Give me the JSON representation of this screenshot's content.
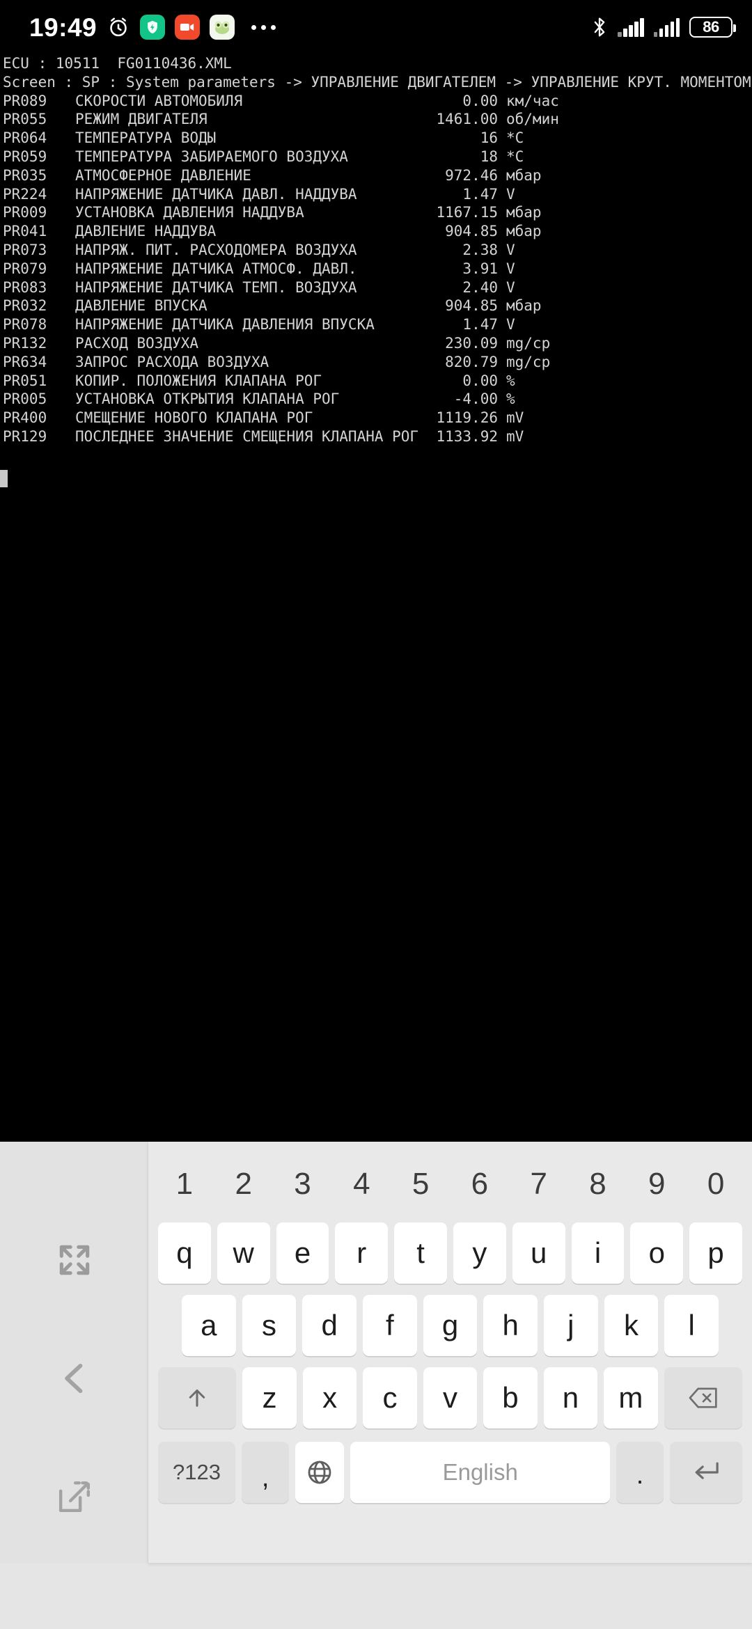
{
  "statusbar": {
    "clock": "19:49",
    "alarm_icon": "alarm-clock-icon",
    "app_icons": [
      {
        "name": "security-shield-app-icon",
        "bg": "#12c487",
        "glyph": "⚡"
      },
      {
        "name": "video-camera-app-icon",
        "bg": "#f0492b",
        "glyph": "■"
      },
      {
        "name": "frog-face-app-icon",
        "bg": "#f3f7ee",
        "glyph": "●"
      }
    ],
    "overflow_label": "•••",
    "bluetooth_icon": "bluetooth-icon",
    "signal_icon": "cellular-signal-icon",
    "battery_level": "86"
  },
  "console": {
    "header_ecu": "ECU : 10511  FG0110436.XML",
    "header_screen": "Screen : SP : System parameters -> УПРАВЛЕНИЕ ДВИГАТЕЛЕМ -> УПРАВЛЕНИЕ КРУТ. МОМЕНТОМ",
    "rows": [
      {
        "id": "PR089",
        "name": "СКОРОСТИ АВТОМОБИЛЯ",
        "value": "0.00",
        "unit": "км/час"
      },
      {
        "id": "PR055",
        "name": "РЕЖИМ ДВИГАТЕЛЯ",
        "value": "1461.00",
        "unit": "об/мин"
      },
      {
        "id": "PR064",
        "name": "ТЕМПЕРАТУРА ВОДЫ",
        "value": "16",
        "unit": "*C"
      },
      {
        "id": "PR059",
        "name": "ТЕМПЕРАТУРА ЗАБИРАЕМОГО ВОЗДУХА",
        "value": "18",
        "unit": "*C"
      },
      {
        "id": "PR035",
        "name": "АТМОСФЕРНОЕ ДАВЛЕНИЕ",
        "value": "972.46",
        "unit": "мбар"
      },
      {
        "id": "PR224",
        "name": "НАПРЯЖЕНИЕ ДАТЧИКА ДАВЛ. НАДДУВА",
        "value": "1.47",
        "unit": "V"
      },
      {
        "id": "PR009",
        "name": "УСТАНОВКА ДАВЛЕНИЯ НАДДУВА",
        "value": "1167.15",
        "unit": "мбар"
      },
      {
        "id": "PR041",
        "name": "ДАВЛЕНИЕ НАДДУВА",
        "value": "904.85",
        "unit": "мбар"
      },
      {
        "id": "PR073",
        "name": "НАПРЯЖ. ПИТ. РАСХОДОМЕРА ВОЗДУХА",
        "value": "2.38",
        "unit": "V"
      },
      {
        "id": "PR079",
        "name": "НАПРЯЖЕНИЕ ДАТЧИКА АТМОСФ. ДАВЛ.",
        "value": "3.91",
        "unit": "V"
      },
      {
        "id": "PR083",
        "name": "НАПРЯЖЕНИЕ ДАТЧИКА ТЕМП. ВОЗДУХА",
        "value": "2.40",
        "unit": "V"
      },
      {
        "id": "PR032",
        "name": "ДАВЛЕНИЕ ВПУСКА",
        "value": "904.85",
        "unit": "мбар"
      },
      {
        "id": "PR078",
        "name": "НАПРЯЖЕНИЕ ДАТЧИКА ДАВЛЕНИЯ ВПУСКА",
        "value": "1.47",
        "unit": "V"
      },
      {
        "id": "PR132",
        "name": "РАСХОД ВОЗДУХА",
        "value": "230.09",
        "unit": "mg/cp"
      },
      {
        "id": "PR634",
        "name": "ЗАПРОС РАСХОДА ВОЗДУХА",
        "value": "820.79",
        "unit": "mg/cp"
      },
      {
        "id": "PR051",
        "name": "КОПИР. ПОЛОЖЕНИЯ КЛАПАНА РОГ",
        "value": "0.00",
        "unit": "%"
      },
      {
        "id": "PR005",
        "name": "УСТАНОВКА ОТКРЫТИЯ КЛАПАНА РОГ",
        "value": "-4.00",
        "unit": "%"
      },
      {
        "id": "PR400",
        "name": "СМЕЩЕНИЕ НОВОГО КЛАПАНА РОГ",
        "value": "1119.26",
        "unit": "mV"
      },
      {
        "id": "PR129",
        "name": "ПОСЛЕДНЕЕ ЗНАЧЕНИЕ СМЕЩЕНИЯ КЛАПАНА РОГ",
        "value": "1133.92",
        "unit": "mV"
      }
    ]
  },
  "navstrip": {
    "fullscreen_icon": "fullscreen-expand-icon",
    "back_icon": "chevron-left-back-icon",
    "popout_icon": "pop-out-window-icon"
  },
  "keyboard": {
    "numbers": [
      "1",
      "2",
      "3",
      "4",
      "5",
      "6",
      "7",
      "8",
      "9",
      "0"
    ],
    "row1": [
      "q",
      "w",
      "e",
      "r",
      "t",
      "y",
      "u",
      "i",
      "o",
      "p"
    ],
    "row2": [
      "a",
      "s",
      "d",
      "f",
      "g",
      "h",
      "j",
      "k",
      "l"
    ],
    "row3_letters": [
      "z",
      "x",
      "c",
      "v",
      "b",
      "n",
      "m"
    ],
    "shift_icon": "shift-arrow-up-icon",
    "backspace_icon": "backspace-delete-icon",
    "symbols_label": "?123",
    "comma_label": ",",
    "globe_icon": "language-globe-icon",
    "space_label": "English",
    "period_label": ".",
    "enter_icon": "enter-return-icon"
  },
  "colors": {
    "console_bg": "#000000",
    "console_text": "#d4d4d4",
    "keyboard_bg": "#e9e9e9",
    "key_bg": "#ffffff",
    "mod_key_bg": "#e0e0e0"
  }
}
